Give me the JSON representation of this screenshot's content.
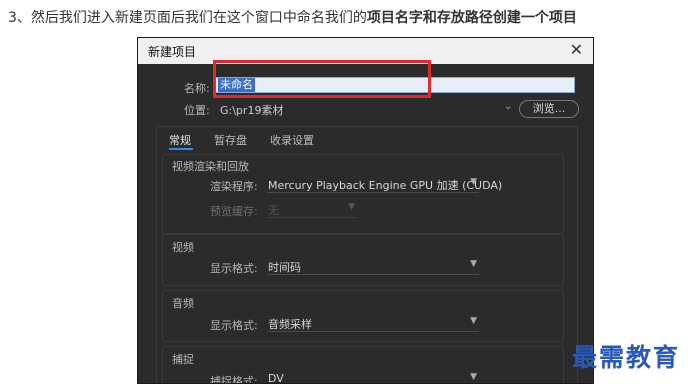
{
  "instruction": {
    "prefix": "3、然后我们进入新建页面后我们在这个窗口中命名我们的",
    "bold": "项目名字和存放路径创建一个项目"
  },
  "dialog": {
    "title": "新建项目",
    "close_glyph": "✕",
    "name_label": "名称:",
    "name_value": "未命名",
    "location_label": "位置:",
    "location_value": "G:\\pr19素材",
    "browse_label": "浏览..."
  },
  "tabs": [
    {
      "label": "常规",
      "active": true
    },
    {
      "label": "暂存盘",
      "active": false
    },
    {
      "label": "收录设置",
      "active": false
    }
  ],
  "sections": {
    "video_render": {
      "title": "视频渲染和回放",
      "renderer_label": "渲染程序:",
      "renderer_value": "Mercury Playback Engine GPU 加速 (CUDA)",
      "preview_cache_label": "预览缓存:",
      "preview_cache_value": "无"
    },
    "video": {
      "title": "视频",
      "display_format_label": "显示格式:",
      "display_format_value": "时间码"
    },
    "audio": {
      "title": "音频",
      "display_format_label": "显示格式:",
      "display_format_value": "音频采样"
    },
    "capture": {
      "title": "捕捉",
      "capture_format_label": "捕捉格式:",
      "capture_format_value": "DV"
    }
  },
  "watermark": "最需教育",
  "colors": {
    "highlight_box": "#e02b2b",
    "dialog_bg": "#2b2b2b",
    "tab_accent": "#2d8ceb",
    "watermark": "#2a59b8"
  },
  "icons": {
    "dropdown": "chevron-down-icon",
    "close": "close-icon"
  }
}
